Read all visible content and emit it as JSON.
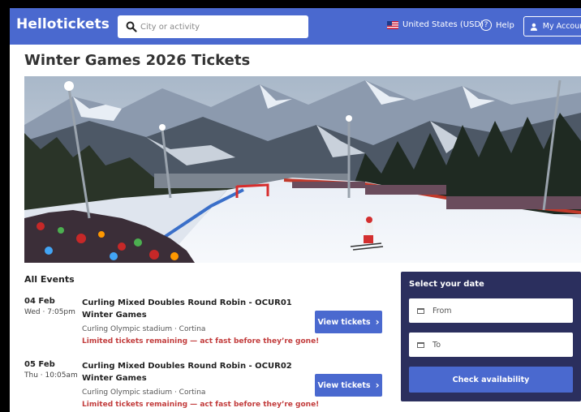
{
  "header": {
    "logo": "Hellotickets",
    "search_placeholder": "City or activity",
    "locale": "United States (USD)",
    "help": "Help",
    "account": "My Account"
  },
  "page": {
    "title": "Winter Games 2026 Tickets"
  },
  "events": {
    "heading": "All Events",
    "items": [
      {
        "date": "04 Feb",
        "time": "Wed · 7:05pm",
        "name": "Curling Mixed Doubles Round Robin - OCUR01 Winter Games",
        "venue": "Curling Olympic stadium · Cortina",
        "alert": "Limited tickets remaining — act fast before they’re gone!",
        "button": "View tickets"
      },
      {
        "date": "05 Feb",
        "time": "Thu · 10:05am",
        "name": "Curling Mixed Doubles Round Robin - OCUR02 Winter Games",
        "venue": "Curling Olympic stadium · Cortina",
        "alert": "Limited tickets remaining — act fast before they’re gone!",
        "button": "View tickets"
      }
    ]
  },
  "datebox": {
    "heading": "Select your date",
    "from": "From",
    "to": "To",
    "button": "Check availability"
  },
  "colors": {
    "brand": "#4a69cf",
    "panel": "#2b2f5e",
    "alert": "#c23c3c"
  }
}
